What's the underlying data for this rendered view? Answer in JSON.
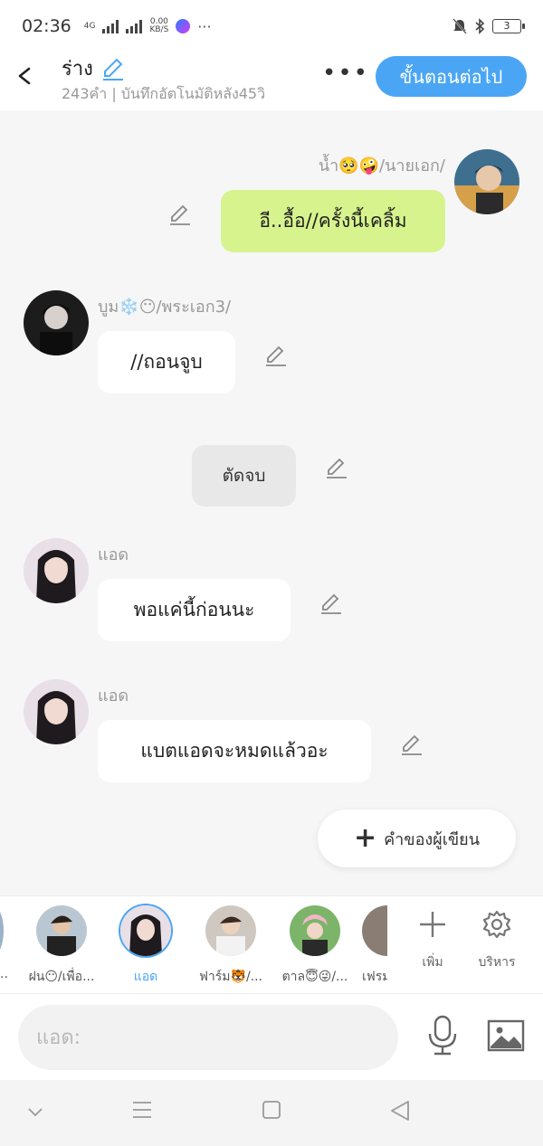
{
  "status": {
    "time": "02:36",
    "network": "4G",
    "speed_value": "0.00",
    "speed_unit": "KB/S",
    "more": "···",
    "battery": "3"
  },
  "header": {
    "title": "ร่าง",
    "subtitle": "243คำ | บันทึกอัตโนมัติหลัง45วิ",
    "more": "•••",
    "next_button": "ขั้นตอนต่อไป"
  },
  "messages": [
    {
      "speaker": "น้ำ🥺🤪/นายเอก/",
      "text": "อี..อื้อ//ครั้งนี้เคลิ้ม",
      "side": "right"
    },
    {
      "speaker": "บูม❄️😶/พระเอก3/",
      "text": "//ถอนจูบ",
      "side": "left"
    },
    {
      "speaker": "",
      "text": "ตัดจบ",
      "side": "center"
    },
    {
      "speaker": "แอด",
      "text": "พอแค่นี้ก่อนนะ",
      "side": "left"
    },
    {
      "speaker": "แอด",
      "text": "แบตแอดจะหมดแล้วอะ",
      "side": "left"
    }
  ],
  "writer_button": "คำของผู้เขียน",
  "characters": [
    {
      "label": "ฝน😶/เพื่อ..."
    },
    {
      "label": "แอด",
      "selected": true
    },
    {
      "label": "ฟาร์ม🐯/..."
    },
    {
      "label": "ตาล😇😜/..."
    },
    {
      "label": "เฟรม"
    }
  ],
  "tools": {
    "add": "เพิ่ม",
    "manage": "บริหาร"
  },
  "input": {
    "placeholder": "แอด:"
  },
  "colors": {
    "accent": "#4aa6f5",
    "bubble_green": "#d7f38d",
    "background": "#f6f6f6"
  }
}
